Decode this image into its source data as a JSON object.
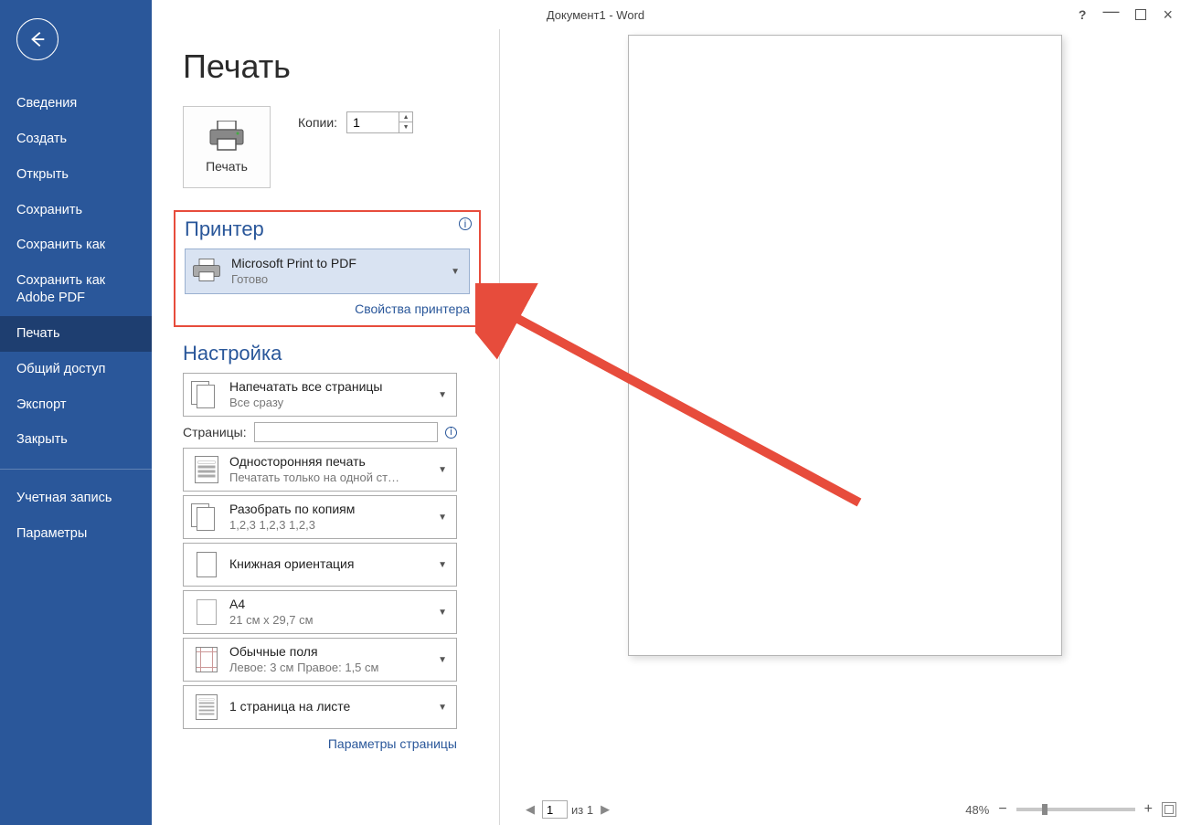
{
  "window": {
    "title": "Документ1 - Word"
  },
  "sidebar": {
    "items": [
      {
        "label": "Сведения"
      },
      {
        "label": "Создать"
      },
      {
        "label": "Открыть"
      },
      {
        "label": "Сохранить"
      },
      {
        "label": "Сохранить как"
      },
      {
        "label": "Сохранить как Adobe PDF"
      },
      {
        "label": "Печать",
        "active": true
      },
      {
        "label": "Общий доступ"
      },
      {
        "label": "Экспорт"
      },
      {
        "label": "Закрыть"
      }
    ],
    "footer": [
      {
        "label": "Учетная запись"
      },
      {
        "label": "Параметры"
      }
    ]
  },
  "print": {
    "page_title": "Печать",
    "print_button": "Печать",
    "copies_label": "Копии:",
    "copies_value": "1",
    "printer": {
      "section_title": "Принтер",
      "name": "Microsoft Print to PDF",
      "status": "Готово",
      "properties_link": "Свойства принтера"
    },
    "settings": {
      "section_title": "Настройка",
      "print_range": {
        "main": "Напечатать все страницы",
        "sub": "Все сразу"
      },
      "pages_label": "Страницы:",
      "pages_value": "",
      "duplex": {
        "main": "Односторонняя печать",
        "sub": "Печатать только на одной ст…"
      },
      "collate": {
        "main": "Разобрать по копиям",
        "sub": "1,2,3    1,2,3    1,2,3"
      },
      "orientation": {
        "main": "Книжная ориентация",
        "sub": ""
      },
      "paper": {
        "main": "A4",
        "sub": "21 см x 29,7 см"
      },
      "margins": {
        "main": "Обычные поля",
        "sub": "Левое:  3 см   Правое:  1,5 см"
      },
      "pages_per_sheet": {
        "main": "1 страница на листе",
        "sub": ""
      },
      "page_setup_link": "Параметры страницы"
    }
  },
  "preview": {
    "page_current": "1",
    "page_total_text": "из 1",
    "zoom_text": "48%"
  }
}
